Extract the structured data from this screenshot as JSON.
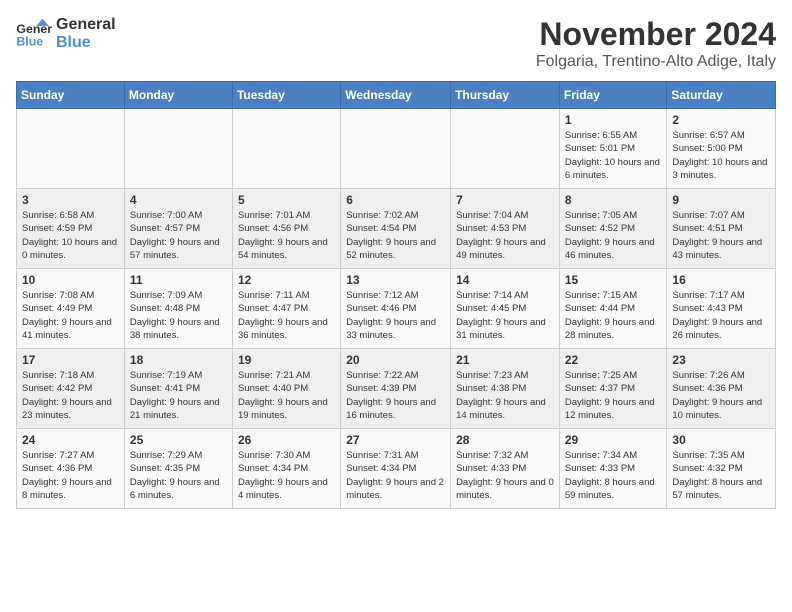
{
  "logo": {
    "line1": "General",
    "line2": "Blue"
  },
  "title": "November 2024",
  "location": "Folgaria, Trentino-Alto Adige, Italy",
  "days_of_week": [
    "Sunday",
    "Monday",
    "Tuesday",
    "Wednesday",
    "Thursday",
    "Friday",
    "Saturday"
  ],
  "weeks": [
    [
      {
        "day": "",
        "info": ""
      },
      {
        "day": "",
        "info": ""
      },
      {
        "day": "",
        "info": ""
      },
      {
        "day": "",
        "info": ""
      },
      {
        "day": "",
        "info": ""
      },
      {
        "day": "1",
        "info": "Sunrise: 6:55 AM\nSunset: 5:01 PM\nDaylight: 10 hours and 6 minutes."
      },
      {
        "day": "2",
        "info": "Sunrise: 6:57 AM\nSunset: 5:00 PM\nDaylight: 10 hours and 3 minutes."
      }
    ],
    [
      {
        "day": "3",
        "info": "Sunrise: 6:58 AM\nSunset: 4:59 PM\nDaylight: 10 hours and 0 minutes."
      },
      {
        "day": "4",
        "info": "Sunrise: 7:00 AM\nSunset: 4:57 PM\nDaylight: 9 hours and 57 minutes."
      },
      {
        "day": "5",
        "info": "Sunrise: 7:01 AM\nSunset: 4:56 PM\nDaylight: 9 hours and 54 minutes."
      },
      {
        "day": "6",
        "info": "Sunrise: 7:02 AM\nSunset: 4:54 PM\nDaylight: 9 hours and 52 minutes."
      },
      {
        "day": "7",
        "info": "Sunrise: 7:04 AM\nSunset: 4:53 PM\nDaylight: 9 hours and 49 minutes."
      },
      {
        "day": "8",
        "info": "Sunrise: 7:05 AM\nSunset: 4:52 PM\nDaylight: 9 hours and 46 minutes."
      },
      {
        "day": "9",
        "info": "Sunrise: 7:07 AM\nSunset: 4:51 PM\nDaylight: 9 hours and 43 minutes."
      }
    ],
    [
      {
        "day": "10",
        "info": "Sunrise: 7:08 AM\nSunset: 4:49 PM\nDaylight: 9 hours and 41 minutes."
      },
      {
        "day": "11",
        "info": "Sunrise: 7:09 AM\nSunset: 4:48 PM\nDaylight: 9 hours and 38 minutes."
      },
      {
        "day": "12",
        "info": "Sunrise: 7:11 AM\nSunset: 4:47 PM\nDaylight: 9 hours and 36 minutes."
      },
      {
        "day": "13",
        "info": "Sunrise: 7:12 AM\nSunset: 4:46 PM\nDaylight: 9 hours and 33 minutes."
      },
      {
        "day": "14",
        "info": "Sunrise: 7:14 AM\nSunset: 4:45 PM\nDaylight: 9 hours and 31 minutes."
      },
      {
        "day": "15",
        "info": "Sunrise: 7:15 AM\nSunset: 4:44 PM\nDaylight: 9 hours and 28 minutes."
      },
      {
        "day": "16",
        "info": "Sunrise: 7:17 AM\nSunset: 4:43 PM\nDaylight: 9 hours and 26 minutes."
      }
    ],
    [
      {
        "day": "17",
        "info": "Sunrise: 7:18 AM\nSunset: 4:42 PM\nDaylight: 9 hours and 23 minutes."
      },
      {
        "day": "18",
        "info": "Sunrise: 7:19 AM\nSunset: 4:41 PM\nDaylight: 9 hours and 21 minutes."
      },
      {
        "day": "19",
        "info": "Sunrise: 7:21 AM\nSunset: 4:40 PM\nDaylight: 9 hours and 19 minutes."
      },
      {
        "day": "20",
        "info": "Sunrise: 7:22 AM\nSunset: 4:39 PM\nDaylight: 9 hours and 16 minutes."
      },
      {
        "day": "21",
        "info": "Sunrise: 7:23 AM\nSunset: 4:38 PM\nDaylight: 9 hours and 14 minutes."
      },
      {
        "day": "22",
        "info": "Sunrise: 7:25 AM\nSunset: 4:37 PM\nDaylight: 9 hours and 12 minutes."
      },
      {
        "day": "23",
        "info": "Sunrise: 7:26 AM\nSunset: 4:36 PM\nDaylight: 9 hours and 10 minutes."
      }
    ],
    [
      {
        "day": "24",
        "info": "Sunrise: 7:27 AM\nSunset: 4:36 PM\nDaylight: 9 hours and 8 minutes."
      },
      {
        "day": "25",
        "info": "Sunrise: 7:29 AM\nSunset: 4:35 PM\nDaylight: 9 hours and 6 minutes."
      },
      {
        "day": "26",
        "info": "Sunrise: 7:30 AM\nSunset: 4:34 PM\nDaylight: 9 hours and 4 minutes."
      },
      {
        "day": "27",
        "info": "Sunrise: 7:31 AM\nSunset: 4:34 PM\nDaylight: 9 hours and 2 minutes."
      },
      {
        "day": "28",
        "info": "Sunrise: 7:32 AM\nSunset: 4:33 PM\nDaylight: 9 hours and 0 minutes."
      },
      {
        "day": "29",
        "info": "Sunrise: 7:34 AM\nSunset: 4:33 PM\nDaylight: 8 hours and 59 minutes."
      },
      {
        "day": "30",
        "info": "Sunrise: 7:35 AM\nSunset: 4:32 PM\nDaylight: 8 hours and 57 minutes."
      }
    ]
  ]
}
